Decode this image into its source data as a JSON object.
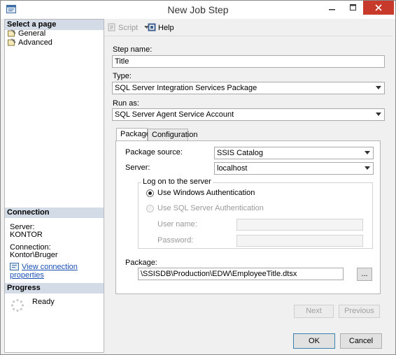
{
  "window": {
    "title": "New Job Step"
  },
  "left_pane": {
    "select_page_header": "Select a page",
    "pages": [
      {
        "label": "General",
        "icon": "wrench-icon"
      },
      {
        "label": "Advanced",
        "icon": "wrench-icon"
      }
    ],
    "connection_header": "Connection",
    "server_label": "Server:",
    "server_value": "KONTOR",
    "connection_label": "Connection:",
    "connection_value": "Kontor\\Bruger",
    "view_connection_link": "View connection properties",
    "progress_header": "Progress",
    "progress_status": "Ready"
  },
  "toolbar": {
    "script_label": "Script",
    "help_label": "Help"
  },
  "form": {
    "step_name_label": "Step name:",
    "step_name_value": "Title",
    "type_label": "Type:",
    "type_value": "SQL Server Integration Services Package",
    "run_as_label": "Run as:",
    "run_as_value": "SQL Server Agent Service Account",
    "tabs": [
      "Package",
      "Configuration"
    ],
    "package_source_label": "Package source:",
    "package_source_value": "SSIS Catalog",
    "server_label": "Server:",
    "server_value": "localhost",
    "logon_group_title": "Log on to the server",
    "windows_auth_label": "Use Windows Authentication",
    "sql_auth_label": "Use SQL Server Authentication",
    "username_label": "User name:",
    "password_label": "Password:",
    "package_label": "Package:",
    "package_value": "\\SSISDB\\Production\\EDW\\EmployeeTitle.dtsx",
    "browse_label": "..."
  },
  "buttons": {
    "next": "Next",
    "previous": "Previous",
    "ok": "OK",
    "cancel": "Cancel"
  },
  "colors": {
    "close_button": "#c7392a",
    "section_header": "#d3dbe6",
    "link": "#1a4fb5"
  }
}
